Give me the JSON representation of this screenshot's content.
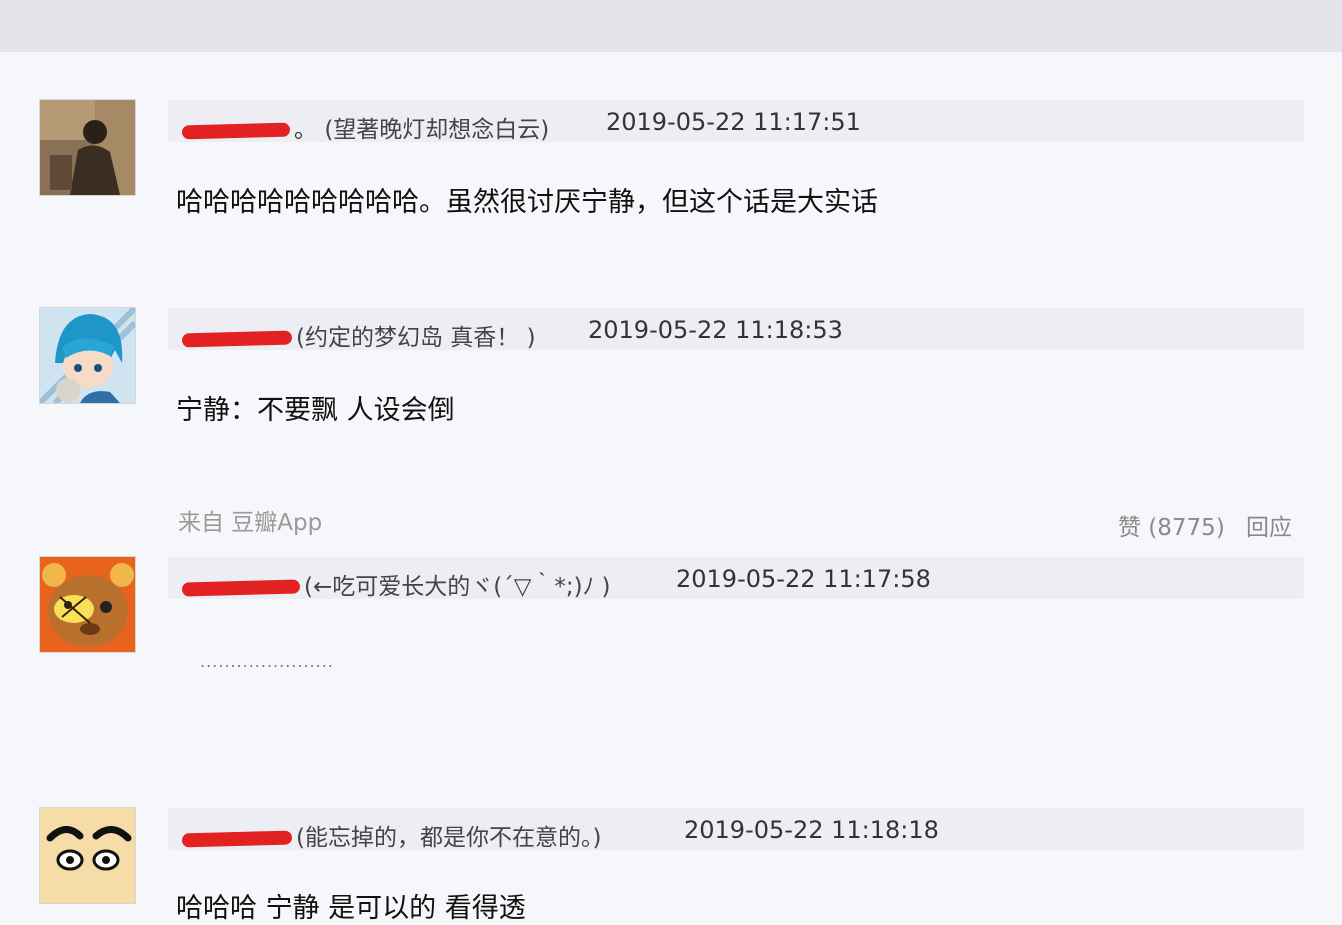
{
  "comments": [
    {
      "user_suffix": "。",
      "signature": "(望著晚灯却想念白云)",
      "time": "2019-05-22 11:17:51",
      "content": "哈哈哈哈哈哈哈哈哈。虽然很讨厌宁静，但这个话是大实话",
      "avatar": "photo-avatar"
    },
    {
      "user_suffix": "",
      "signature": "(约定的梦幻岛 真香！ )",
      "time": "2019-05-22 11:18:53",
      "content": "宁静：不要飘 人设会倒",
      "avatar": "anime-boy-avatar",
      "source": "来自 豆瓣App",
      "likes": "赞 (8775)",
      "reply": "回应"
    },
    {
      "user_suffix": "",
      "signature": "(←吃可爱长大的ヾ(´▽｀*;)ﾉ )",
      "time": "2019-05-22 11:17:58",
      "content": "......................",
      "avatar": "bear-avatar"
    },
    {
      "user_suffix": "",
      "signature": "(能忘掉的，都是你不在意的。)",
      "time": "2019-05-22 11:18:18",
      "content": "哈哈哈 宁静 是可以的 看得透",
      "avatar": "cartoon-face-avatar"
    }
  ],
  "colors": {
    "redaction": "#e22222",
    "meta_bg": "#eceef4",
    "page_bg": "#f6f7fa"
  }
}
